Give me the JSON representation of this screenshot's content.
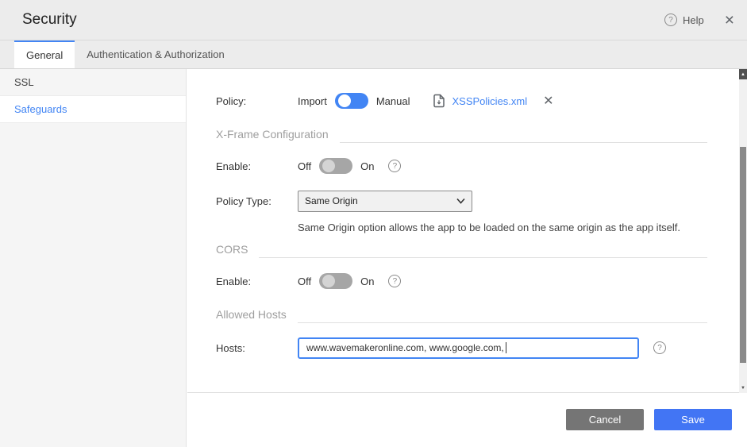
{
  "header": {
    "title": "Security",
    "help": "Help"
  },
  "tabs": {
    "items": [
      {
        "label": "General"
      },
      {
        "label": "Authentication & Authorization"
      }
    ]
  },
  "sidebar": {
    "items": [
      {
        "label": "SSL"
      },
      {
        "label": "Safeguards"
      }
    ]
  },
  "panel": {
    "policy": {
      "label": "Policy:",
      "import_label": "Import",
      "manual_label": "Manual",
      "file_name": "XSSPolicies.xml"
    },
    "xframe": {
      "heading": "X-Frame Configuration",
      "enable_label": "Enable:",
      "off": "Off",
      "on": "On",
      "policy_type_label": "Policy Type:",
      "policy_type_value": "Same Origin",
      "helper": "Same Origin option allows the app to be loaded on the same origin as the app itself."
    },
    "cors": {
      "heading": "CORS",
      "enable_label": "Enable:",
      "off": "Off",
      "on": "On"
    },
    "hosts": {
      "heading": "Allowed Hosts",
      "label": "Hosts:",
      "value": "www.wavemakeronline.com, www.google.com,"
    }
  },
  "footer": {
    "cancel": "Cancel",
    "save": "Save"
  },
  "icons": {
    "help": "?",
    "close": "×",
    "remove": "✕",
    "up": "▲",
    "down": "▼"
  },
  "colors": {
    "accent": "#4285f4",
    "toggle_off": "#a6a6a6",
    "cancel": "#757575"
  }
}
